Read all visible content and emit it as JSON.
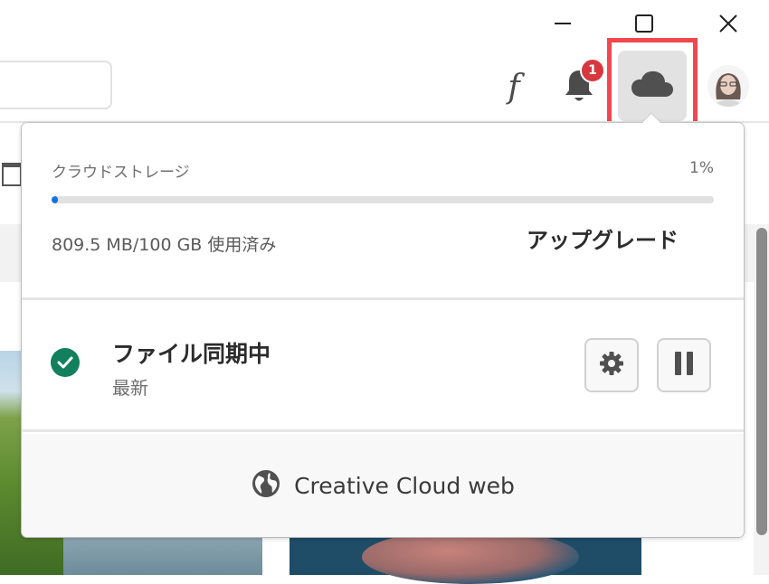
{
  "window_controls": {
    "minimize_icon": "minimize-icon",
    "maximize_icon": "maximize-icon",
    "close_icon": "close-icon"
  },
  "toolbar": {
    "fonts_glyph": "f",
    "notifications": {
      "icon": "bell-icon",
      "badge_count": "1"
    },
    "cloud_icon": "cloud-icon",
    "avatar_icon": "avatar"
  },
  "colors": {
    "accent": "#1473e6",
    "badge": "#d7373f",
    "sync_ok": "#12805c",
    "highlight": "#f0484e"
  },
  "popover": {
    "storage": {
      "title": "クラウドストレージ",
      "percent_label": "1%",
      "percent_value": 0.01,
      "usage": "809.5 MB/100 GB 使用済み",
      "upgrade_label": "アップグレード"
    },
    "sync": {
      "title": "ファイル同期中",
      "status": "最新",
      "settings_icon": "gear-icon",
      "pause_icon": "pause-icon"
    },
    "footer": {
      "icon": "globe-icon",
      "label": "Creative Cloud web"
    }
  }
}
